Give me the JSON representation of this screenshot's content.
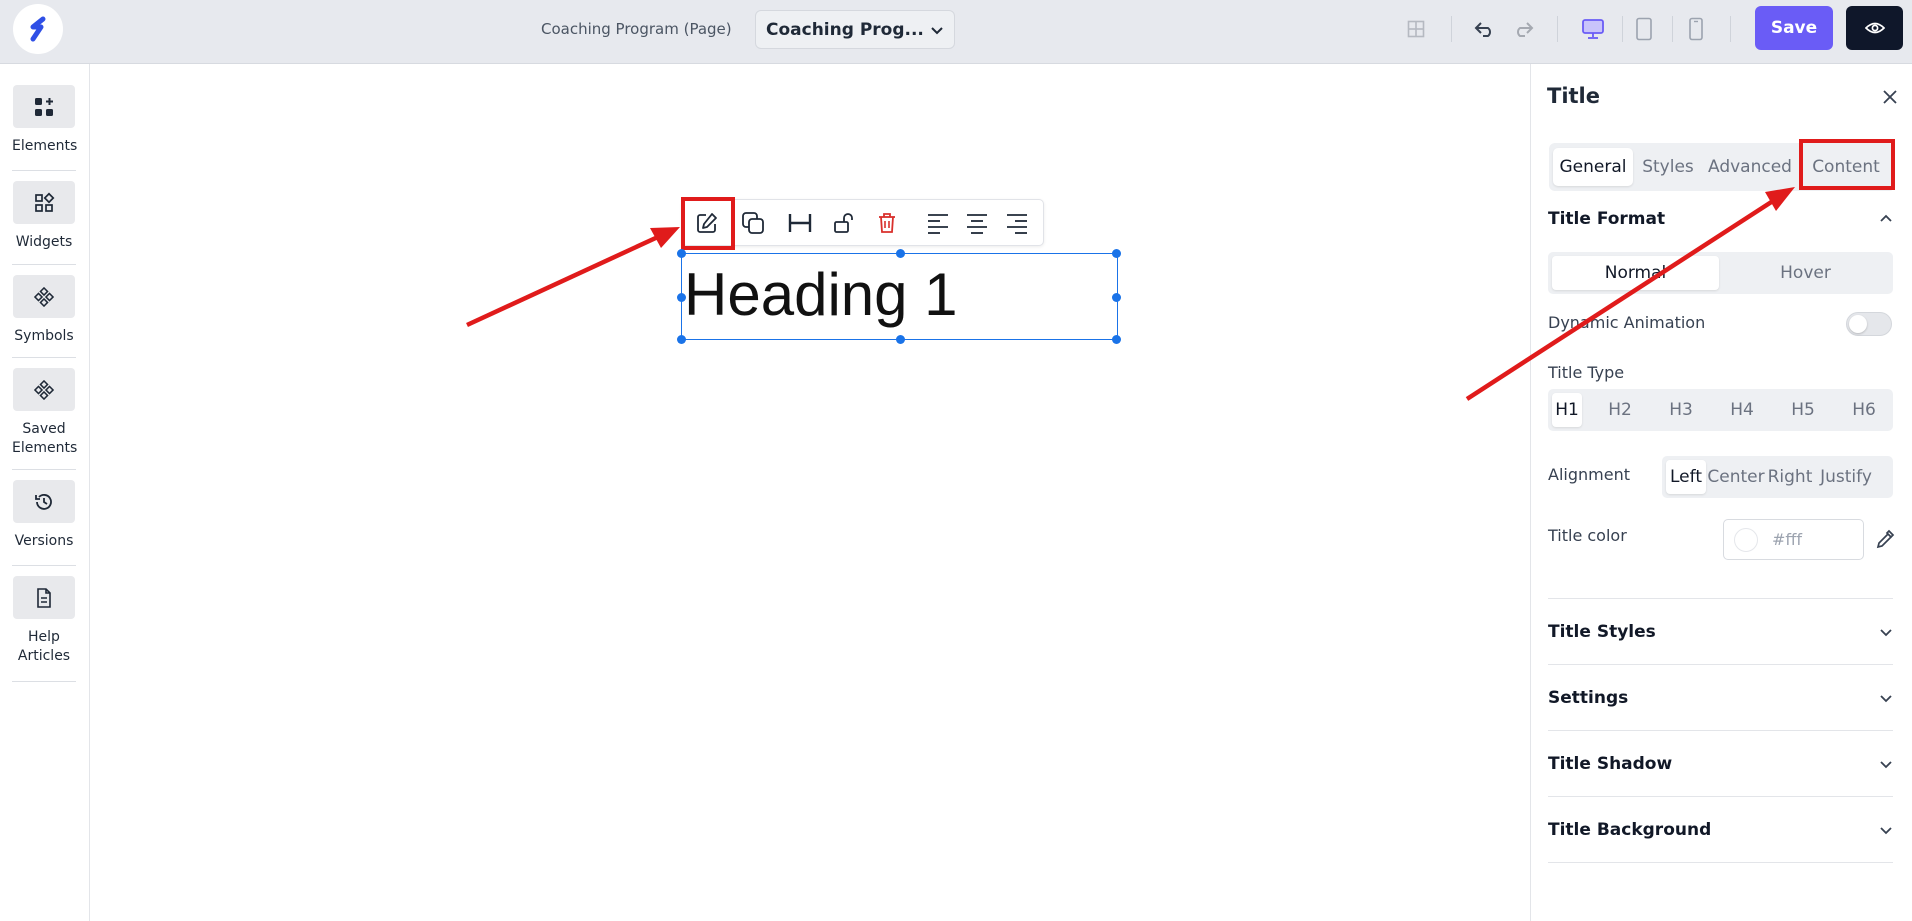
{
  "topbar": {
    "page_label": "Coaching Program (Page)",
    "page_select": "Coaching Prog...",
    "save_label": "Save"
  },
  "sidebar": {
    "items": [
      {
        "label": "Elements",
        "icon": "elements-icon"
      },
      {
        "label": "Widgets",
        "icon": "widgets-icon"
      },
      {
        "label": "Symbols",
        "icon": "symbols-icon"
      },
      {
        "label": "Saved Elements",
        "icon": "saved-elements-icon"
      },
      {
        "label": "Versions",
        "icon": "history-icon"
      },
      {
        "label": "Help Articles",
        "icon": "document-icon"
      }
    ]
  },
  "canvas": {
    "heading_text": "Heading 1"
  },
  "panel": {
    "title": "Title",
    "tabs": [
      {
        "label": "General",
        "active": true
      },
      {
        "label": "Styles",
        "active": false
      },
      {
        "label": "Advanced",
        "active": false
      },
      {
        "label": "Content",
        "active": false
      }
    ],
    "title_format": {
      "heading": "Title Format",
      "states": [
        {
          "label": "Normal",
          "active": true
        },
        {
          "label": "Hover",
          "active": false
        }
      ],
      "dynamic_animation_label": "Dynamic Animation",
      "dynamic_animation_on": false,
      "title_type_label": "Title Type",
      "title_types": [
        "H1",
        "H2",
        "H3",
        "H4",
        "H5",
        "H6"
      ],
      "title_type_selected": "H1",
      "alignment_label": "Alignment",
      "alignments": [
        "Left",
        "Center",
        "Right",
        "Justify"
      ],
      "alignment_selected": "Left",
      "title_color_label": "Title color",
      "title_color_value": "#fff"
    },
    "sections": [
      "Title Styles",
      "Settings",
      "Title Shadow",
      "Title Background"
    ]
  },
  "colors": {
    "accent": "#6a5cf6",
    "selection": "#1a73e8",
    "highlight": "#e01b1b",
    "delete": "#d9302c"
  }
}
